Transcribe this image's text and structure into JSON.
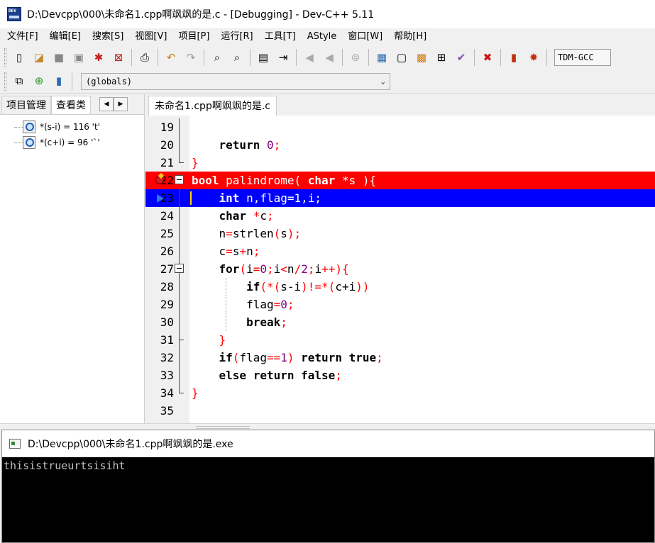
{
  "window": {
    "title": "D:\\Devcpp\\000\\未命名1.cpp啊飒飒的是.c - [Debugging] - Dev-C++ 5.11"
  },
  "menu": [
    {
      "id": "file",
      "label": "文件[F]"
    },
    {
      "id": "edit",
      "label": "编辑[E]"
    },
    {
      "id": "search",
      "label": "搜索[S]"
    },
    {
      "id": "view",
      "label": "视图[V]"
    },
    {
      "id": "project",
      "label": "项目[P]"
    },
    {
      "id": "run",
      "label": "运行[R]"
    },
    {
      "id": "tools",
      "label": "工具[T]"
    },
    {
      "id": "astyle",
      "label": "AStyle"
    },
    {
      "id": "window",
      "label": "窗口[W]"
    },
    {
      "id": "help",
      "label": "帮助[H]"
    }
  ],
  "toolbar": {
    "compiler": "TDM-GCC",
    "scope": "(globals)"
  },
  "left_panel": {
    "tabs": [
      "项目管理",
      "查看类"
    ],
    "watches": [
      "*(s-i) = 116 't'",
      "*(c+i) = 96 '`'"
    ]
  },
  "editor": {
    "tab_label": "未命名1.cpp啊飒飒的是.c",
    "breakpoint_line": 22,
    "execution_line": 23,
    "lines": [
      {
        "n": "19"
      },
      {
        "n": "20"
      },
      {
        "n": "21"
      },
      {
        "n": "22"
      },
      {
        "n": "23"
      },
      {
        "n": "24"
      },
      {
        "n": "25"
      },
      {
        "n": "26"
      },
      {
        "n": "27"
      },
      {
        "n": "28"
      },
      {
        "n": "29"
      },
      {
        "n": "30"
      },
      {
        "n": "31"
      },
      {
        "n": "32"
      },
      {
        "n": "33"
      },
      {
        "n": "34"
      },
      {
        "n": "35"
      }
    ],
    "code": {
      "l20": {
        "kw": "return",
        "num": "0",
        "semi": ";"
      },
      "l21": {
        "brace": "}"
      },
      "l22": {
        "kw1": "bool",
        "name": "palindrome",
        "paren": "(",
        "kw2": "char",
        "star": "*",
        "arg": "s",
        "close": ")",
        "brace": "{"
      },
      "l23": {
        "kw": "int",
        "decl1": "n,flag",
        "eq": "=",
        "num": "1",
        "decl2": ",i",
        "semi": ";"
      },
      "l24": {
        "kw": "char",
        "star": "*",
        "var": "c",
        "semi": ";"
      },
      "l25": {
        "lhs": "n",
        "eq": "=",
        "call": "strlen",
        "lp": "(",
        "arg": "s",
        "rp": ")",
        "semi": ";"
      },
      "l26": {
        "lhs": "c",
        "eq": "=",
        "a": "s",
        "plus": "+",
        "b": "n",
        "semi": ";"
      },
      "l27": {
        "kw": "for",
        "lp": "(",
        "i1": "i",
        "eq": "=",
        "n0": "0",
        "s1": ";",
        "i2": "i",
        "lt": "<",
        "n": "n",
        "div": "/",
        "n2": "2",
        "s2": ";",
        "i3": "i",
        "inc": "++",
        "rp": ")",
        "brace": "{"
      },
      "l28": {
        "kw": "if",
        "p1": "(*(",
        "e1": "s-i",
        "p2": ")!=*(",
        "e2": "c+i",
        "p3": "))"
      },
      "l29": {
        "var": "flag",
        "eq": "=",
        "num": "0",
        "semi": ";"
      },
      "l30": {
        "kw": "break",
        "semi": ";"
      },
      "l31": {
        "brace": "}"
      },
      "l32": {
        "kw1": "if",
        "lp": "(",
        "var": "flag",
        "eqeq": "==",
        "num": "1",
        "rp": ")",
        "kw2": "return",
        "kw3": "true",
        "semi": ";"
      },
      "l33": {
        "kw1": "else",
        "kw2": "return",
        "kw3": "false",
        "semi": ";"
      },
      "l34": {
        "brace": "}"
      }
    }
  },
  "console": {
    "title": "D:\\Devcpp\\000\\未命名1.cpp啊飒飒的是.exe",
    "output": "thisistrueurtsisiht"
  }
}
